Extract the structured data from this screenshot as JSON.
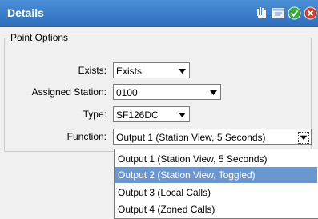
{
  "window": {
    "title": "Details"
  },
  "toolbar_icons": [
    "move-icon",
    "window-icon",
    "confirm-icon",
    "close-icon"
  ],
  "colors": {
    "titlebar": "#3a7ccb",
    "selection": "#6b96cf",
    "confirm": "#3aa83a",
    "close": "#d83a2a"
  },
  "point_options": {
    "legend": "Point Options",
    "exists": {
      "label": "Exists:",
      "value": "Exists"
    },
    "assigned_station": {
      "label": "Assigned Station:",
      "value": "0100"
    },
    "type": {
      "label": "Type:",
      "value": "SF126DC"
    },
    "function": {
      "label": "Function:",
      "value": "Output 1 (Station View, 5 Seconds)"
    }
  },
  "function_dropdown": {
    "options": [
      "Output 1 (Station View, 5 Seconds)",
      "Output 2 (Station View, Toggled)",
      "Output 3 (Local Calls)",
      "Output 4 (Zoned Calls)"
    ],
    "highlighted": "Output 2 (Station View, Toggled)"
  }
}
